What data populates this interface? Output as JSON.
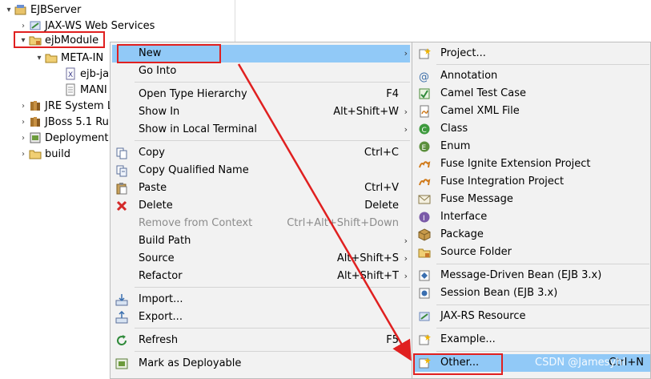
{
  "tree": {
    "items": [
      {
        "label": "EJBServer",
        "twisty": "▾",
        "icon": "project-icon"
      },
      {
        "label": "JAX-WS Web Services",
        "twisty": "›",
        "icon": "webservices-icon"
      },
      {
        "label": "ejbModule",
        "twisty": "▾",
        "icon": "source-folder-icon"
      },
      {
        "label": "META-IN",
        "twisty": "▾",
        "icon": "folder-icon"
      },
      {
        "label": "ejb-jar",
        "twisty": "",
        "icon": "xml-file-icon"
      },
      {
        "label": "MANI",
        "twisty": "",
        "icon": "text-file-icon"
      },
      {
        "label": "JRE System L",
        "twisty": "›",
        "icon": "library-icon"
      },
      {
        "label": "JBoss 5.1 Ru",
        "twisty": "›",
        "icon": "library-icon"
      },
      {
        "label": "Deployment",
        "twisty": "›",
        "icon": "deployment-icon"
      },
      {
        "label": "build",
        "twisty": "›",
        "icon": "folder-icon"
      }
    ]
  },
  "menu": {
    "new": {
      "label": "New"
    },
    "go_into": {
      "label": "Go Into"
    },
    "open_type_hierarchy": {
      "label": "Open Type Hierarchy",
      "shortcut": "F4"
    },
    "show_in": {
      "label": "Show In",
      "shortcut": "Alt+Shift+W"
    },
    "show_in_local_terminal": {
      "label": "Show in Local Terminal"
    },
    "copy": {
      "label": "Copy",
      "shortcut": "Ctrl+C"
    },
    "copy_qualified_name": {
      "label": "Copy Qualified Name"
    },
    "paste": {
      "label": "Paste",
      "shortcut": "Ctrl+V"
    },
    "delete": {
      "label": "Delete",
      "shortcut": "Delete"
    },
    "remove_from_context": {
      "label": "Remove from Context",
      "shortcut": "Ctrl+Alt+Shift+Down"
    },
    "build_path": {
      "label": "Build Path"
    },
    "source": {
      "label": "Source",
      "shortcut": "Alt+Shift+S"
    },
    "refactor": {
      "label": "Refactor",
      "shortcut": "Alt+Shift+T"
    },
    "import": {
      "label": "Import..."
    },
    "export": {
      "label": "Export..."
    },
    "refresh": {
      "label": "Refresh",
      "shortcut": "F5"
    },
    "mark_as_deployable": {
      "label": "Mark as Deployable"
    }
  },
  "submenu": {
    "project": {
      "label": "Project..."
    },
    "annotation": {
      "label": "Annotation"
    },
    "camel_test_case": {
      "label": "Camel Test Case"
    },
    "camel_xml_file": {
      "label": "Camel XML File"
    },
    "class": {
      "label": "Class"
    },
    "enum": {
      "label": "Enum"
    },
    "fuse_ignite": {
      "label": "Fuse Ignite Extension Project"
    },
    "fuse_integration": {
      "label": "Fuse Integration Project"
    },
    "fuse_message": {
      "label": "Fuse Message"
    },
    "interface": {
      "label": "Interface"
    },
    "package": {
      "label": "Package"
    },
    "source_folder": {
      "label": "Source Folder"
    },
    "mdb": {
      "label": "Message-Driven Bean (EJB 3.x)"
    },
    "session_bean": {
      "label": "Session Bean (EJB 3.x)"
    },
    "jaxrs": {
      "label": "JAX-RS Resource"
    },
    "example": {
      "label": "Example..."
    },
    "other": {
      "label": "Other...",
      "shortcut": "Ctrl+N"
    }
  },
  "watermark": "CSDN @Jamesyhl",
  "colors": {
    "highlight": "#91c9f7",
    "annotation": "#e02020",
    "menu_bg": "#f2f2f2"
  }
}
